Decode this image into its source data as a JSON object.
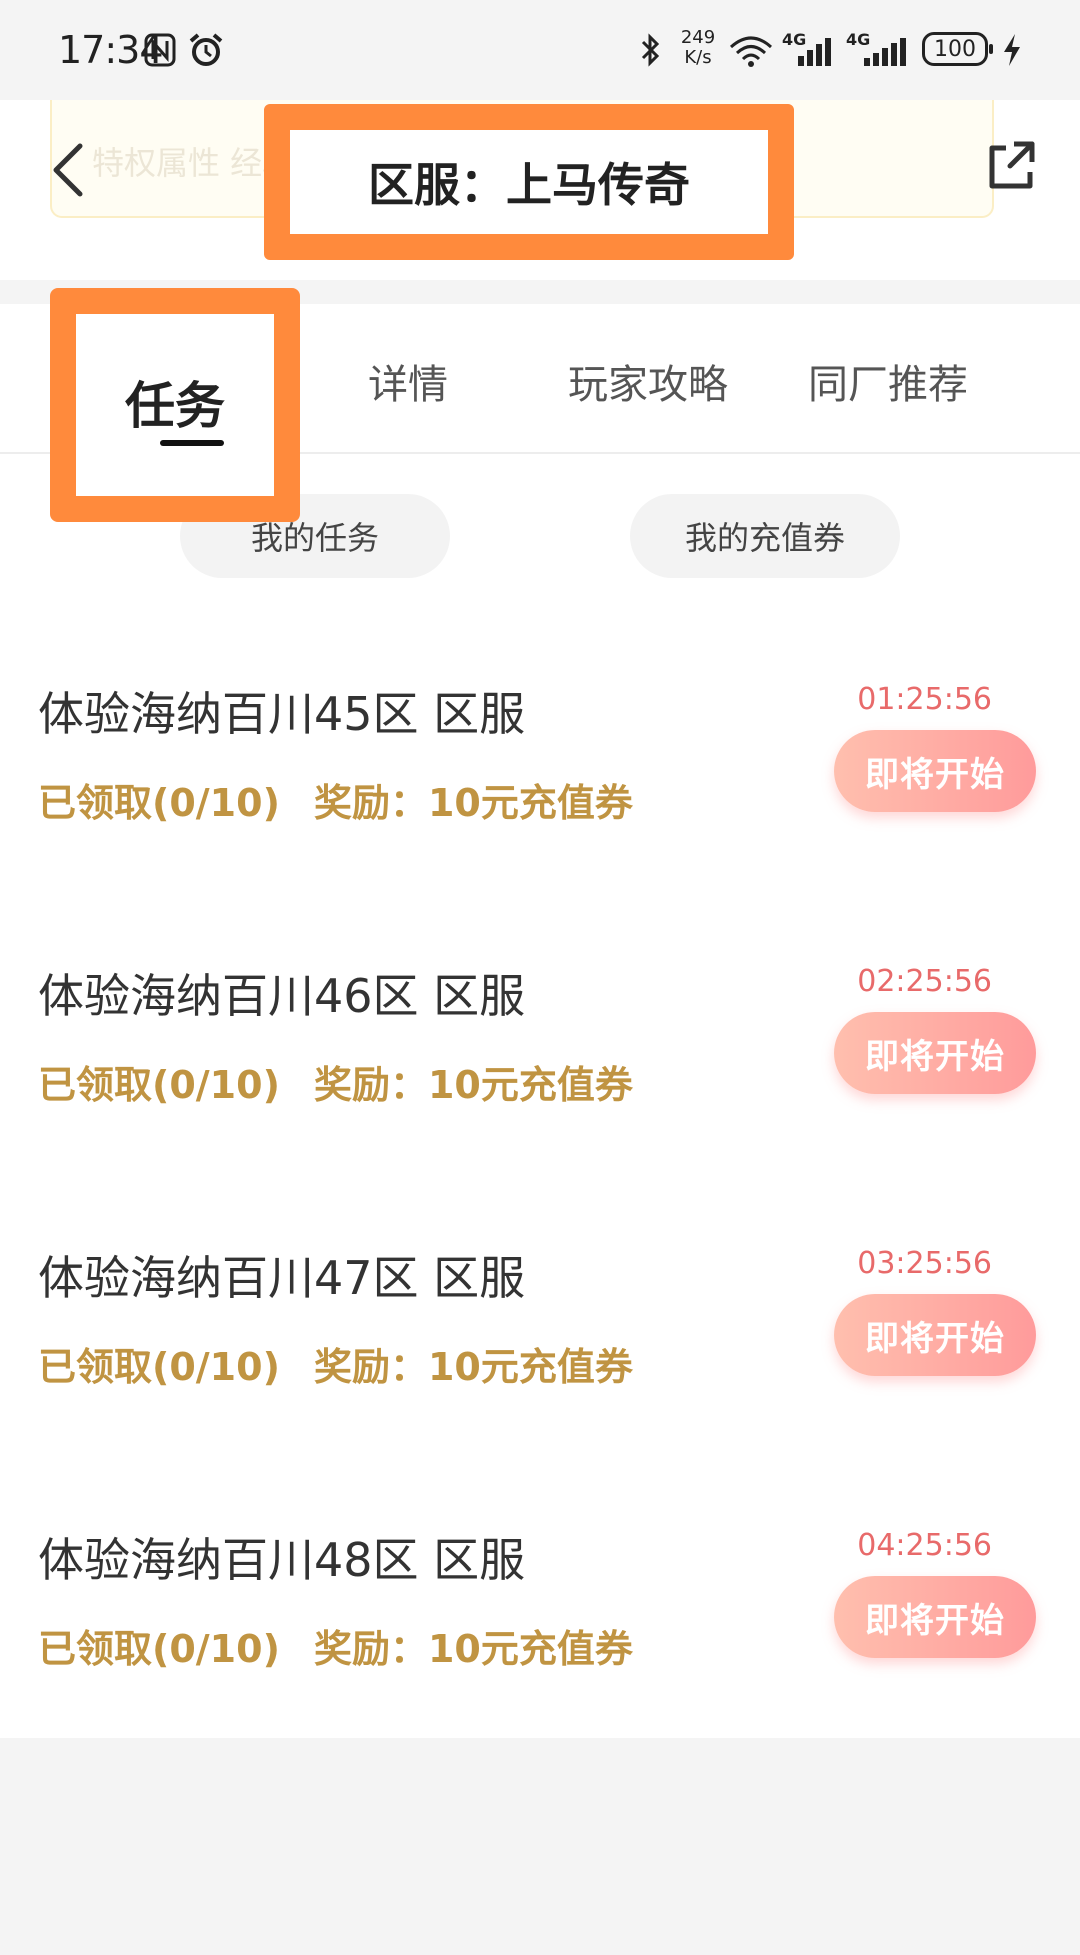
{
  "status_bar": {
    "time": "17:34",
    "net_speed_value": "249",
    "net_speed_unit": "K/s",
    "signal_1_label": "4G",
    "signal_2_label": "4G",
    "battery": "100"
  },
  "header": {
    "title": "区服：上马传奇",
    "background_text": "特权属性    经验值 %、    %、每秒回血…"
  },
  "tabs": [
    {
      "label": "任务"
    },
    {
      "label": "详情"
    },
    {
      "label": "玩家攻略"
    },
    {
      "label": "同厂推荐"
    }
  ],
  "sub_buttons": {
    "my_tasks": "我的任务",
    "my_vouchers": "我的充值券"
  },
  "tasks": [
    {
      "title": "体验海纳百川45区 区服",
      "claimed": "已领取(0/10)",
      "reward": "奖励：10元充值券",
      "timer": "01:25:56",
      "button": "即将开始"
    },
    {
      "title": "体验海纳百川46区 区服",
      "claimed": "已领取(0/10)",
      "reward": "奖励：10元充值券",
      "timer": "02:25:56",
      "button": "即将开始"
    },
    {
      "title": "体验海纳百川47区 区服",
      "claimed": "已领取(0/10)",
      "reward": "奖励：10元充值券",
      "timer": "03:25:56",
      "button": "即将开始"
    },
    {
      "title": "体验海纳百川48区 区服",
      "claimed": "已领取(0/10)",
      "reward": "奖励：10元充值券",
      "timer": "04:25:56",
      "button": "即将开始"
    }
  ],
  "icons": {
    "back": "chevron-left-icon",
    "share": "share-icon",
    "nfc": "nfc-icon",
    "alarm": "alarm-icon",
    "bluetooth": "bluetooth-icon",
    "wifi": "wifi-icon",
    "charging": "charging-icon"
  },
  "colors": {
    "highlight": "#ff8a3c",
    "meta_text": "#c09442",
    "timer_text": "#e86a6a",
    "button_gradient_start": "#ffbfae",
    "button_gradient_end": "#ff9b9b"
  }
}
